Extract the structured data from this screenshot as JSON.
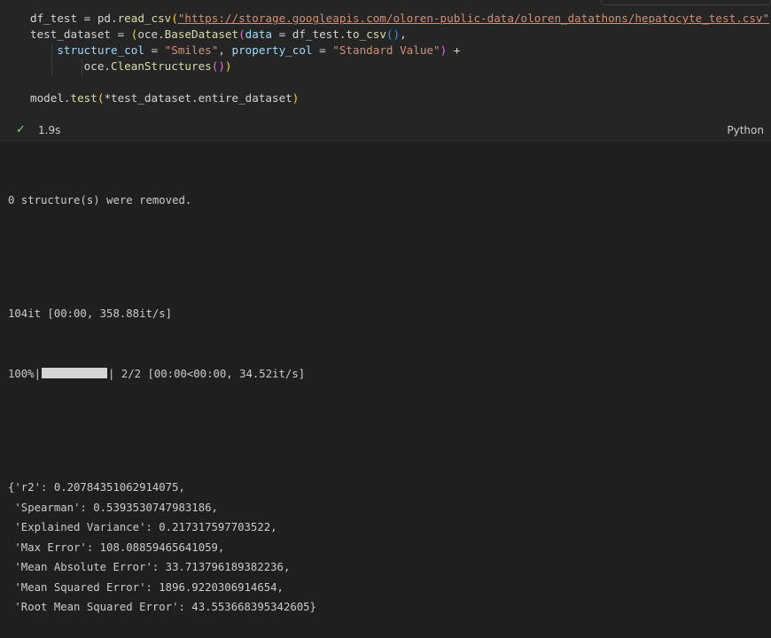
{
  "cell": {
    "code_lines": [
      {
        "parts": [
          {
            "t": "df_test = pd.",
            "c": "op"
          },
          {
            "t": "read_csv",
            "c": "fn"
          },
          {
            "t": "(",
            "c": "p1"
          },
          {
            "t": "\"https://storage.googleapis.com/oloren-public-data/oloren_datathons/hepatocyte_test.csv\"",
            "c": "url"
          },
          {
            "t": ")",
            "c": "p1"
          }
        ]
      },
      {
        "parts": [
          {
            "t": "test_dataset = ",
            "c": "op"
          },
          {
            "t": "(",
            "c": "p1"
          },
          {
            "t": "oce.",
            "c": "op"
          },
          {
            "t": "BaseDataset",
            "c": "fn"
          },
          {
            "t": "(",
            "c": "p2"
          },
          {
            "t": "data",
            "c": "kw-var"
          },
          {
            "t": " = df_test.",
            "c": "op"
          },
          {
            "t": "to_csv",
            "c": "fn"
          },
          {
            "t": "()",
            "c": "p3"
          },
          {
            "t": ",",
            "c": "op"
          }
        ]
      },
      {
        "parts": [
          {
            "t": "    ",
            "c": "op"
          },
          {
            "t": "structure_col",
            "c": "kw-var"
          },
          {
            "t": " = ",
            "c": "op"
          },
          {
            "t": "\"Smiles\"",
            "c": "str"
          },
          {
            "t": ", ",
            "c": "op"
          },
          {
            "t": "property_col",
            "c": "kw-var"
          },
          {
            "t": " = ",
            "c": "op"
          },
          {
            "t": "\"Standard Value\"",
            "c": "str"
          },
          {
            "t": ")",
            "c": "p2"
          },
          {
            "t": " +",
            "c": "op"
          }
        ]
      },
      {
        "parts": [
          {
            "t": "        oce.",
            "c": "op"
          },
          {
            "t": "CleanStructures",
            "c": "fn"
          },
          {
            "t": "()",
            "c": "p2"
          },
          {
            "t": ")",
            "c": "p1"
          }
        ]
      },
      {
        "parts": []
      },
      {
        "parts": [
          {
            "t": "model.",
            "c": "op"
          },
          {
            "t": "test",
            "c": "fn"
          },
          {
            "t": "(",
            "c": "p1"
          },
          {
            "t": "*test_dataset.entire_dataset",
            "c": "op"
          },
          {
            "t": ")",
            "c": "p1"
          }
        ]
      }
    ],
    "exec_time": "1.9s",
    "language": "Python",
    "status_icon": "check-icon",
    "status_color": "#89d185"
  },
  "output": {
    "removed": "0 structure(s) were removed.",
    "progress1": "104it [00:00, 358.88it/s]",
    "progress2_prefix": "100%|",
    "progress2_value": 1.0,
    "progress2_suffix": "| 2/2 [00:00<00:00, 34.52it/s]",
    "metrics": [
      "{'r2': 0.20784351062914075,",
      " 'Spearman': 0.5393530747983186,",
      " 'Explained Variance': 0.217317597703522,",
      " 'Max Error': 108.08859465641059,",
      " 'Mean Absolute Error': 33.713796189382236,",
      " 'Mean Squared Error': 1896.9220306914654,",
      " 'Root Mean Squared Error': 43.553668395342605}"
    ]
  }
}
